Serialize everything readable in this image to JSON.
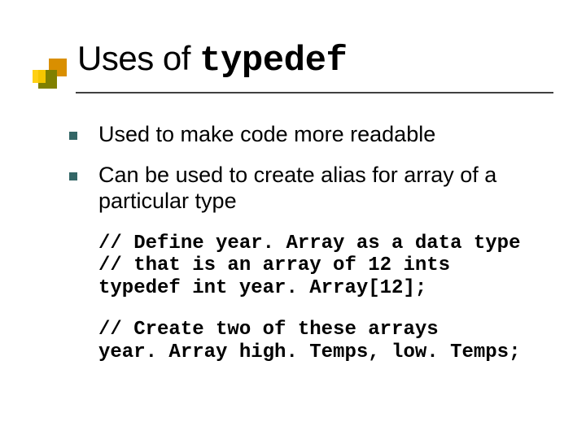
{
  "title": {
    "prefix": "Uses of ",
    "code": "typedef"
  },
  "bullets": [
    "Used to make code more readable",
    "Can be used to create alias for array of a particular type"
  ],
  "code_blocks": [
    "// Define year. Array as a data type\n// that is an array of 12 ints\ntypedef int year. Array[12];",
    "// Create two of these arrays\nyear. Array high. Temps, low. Temps;"
  ]
}
